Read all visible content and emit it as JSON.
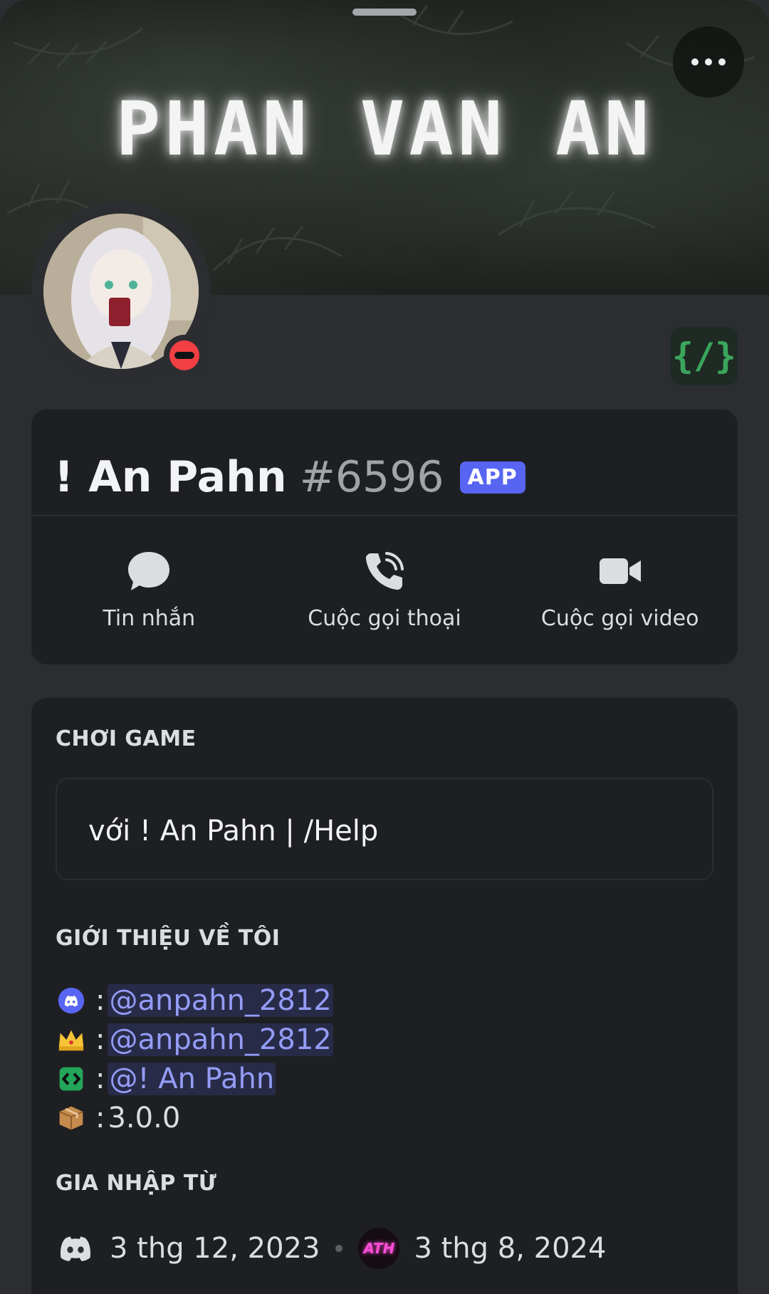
{
  "banner": {
    "title": "PHAN VAN AN"
  },
  "profile": {
    "display_name": "! An Pahn",
    "discriminator": "#6596",
    "badge": "APP",
    "status": "dnd"
  },
  "actions": [
    {
      "label": "Tin nhắn",
      "icon": "message-bubble-icon"
    },
    {
      "label": "Cuộc gọi thoại",
      "icon": "phone-call-icon"
    },
    {
      "label": "Cuộc gọi video",
      "icon": "video-camera-icon"
    }
  ],
  "activity": {
    "section_title": "CHƠI GAME",
    "text": "với ! An Pahn | /Help"
  },
  "about": {
    "section_title": "GIỚI THIỆU VỀ TÔI",
    "lines": [
      {
        "icon": "discord-icon",
        "separator": ":",
        "value": "@anpahn_2812"
      },
      {
        "icon": "crown-icon",
        "separator": ":",
        "value": "@anpahn_2812"
      },
      {
        "icon": "code-icon",
        "separator": ":",
        "value": "@! An Pahn"
      },
      {
        "icon": "package-icon",
        "separator": ":",
        "value": "3.0.0"
      }
    ]
  },
  "joined": {
    "section_title": "GIA NHẬP TỪ",
    "discord_date": "3 thg 12, 2023",
    "server_icon_text": "ATH",
    "server_date": "3 thg 8, 2024"
  },
  "colors": {
    "background": "#2b2d31",
    "card": "#1e1f22",
    "accent": "#5865f2",
    "mention": "#949cf7",
    "dnd": "#f23f43",
    "app_green": "#3ba55c"
  }
}
